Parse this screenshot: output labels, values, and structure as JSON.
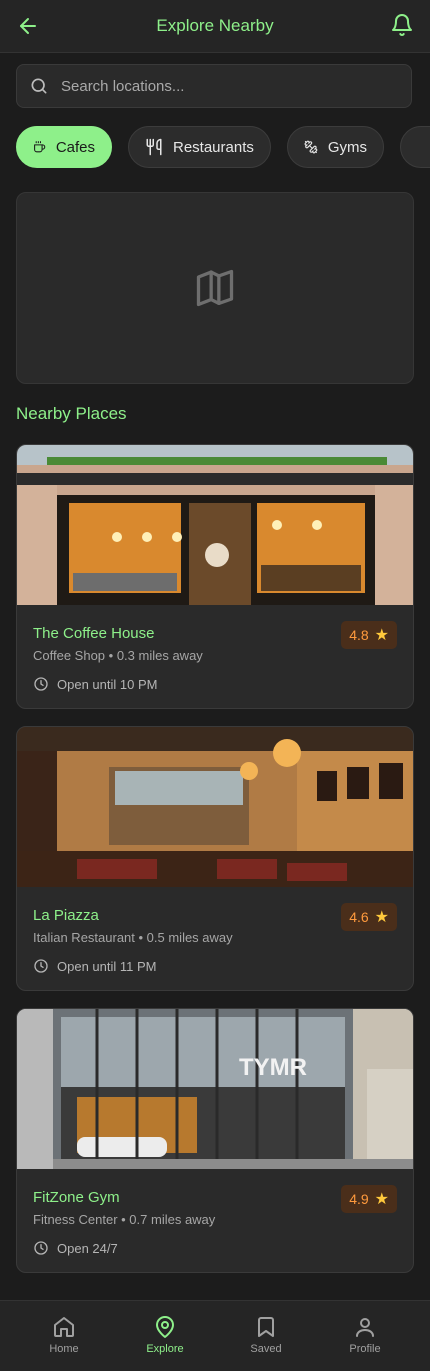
{
  "header": {
    "title": "Explore Nearby",
    "back_icon": "arrow-left-icon",
    "bell_icon": "bell-icon"
  },
  "search": {
    "placeholder": "Search locations...",
    "value": ""
  },
  "categories": [
    {
      "label": "Cafes",
      "icon": "coffee-icon",
      "active": true
    },
    {
      "label": "Restaurants",
      "icon": "utensils-icon",
      "active": false
    },
    {
      "label": "Gyms",
      "icon": "dumbbell-icon",
      "active": false
    }
  ],
  "map": {
    "icon": "map-icon"
  },
  "section_title": "Nearby Places",
  "places": [
    {
      "name": "The Coffee House",
      "meta": "Coffee Shop • 0.3 miles away",
      "hours": "Open until 10 PM",
      "rating": "4.8"
    },
    {
      "name": "La Piazza",
      "meta": "Italian Restaurant • 0.5 miles away",
      "hours": "Open until 11 PM",
      "rating": "4.6"
    },
    {
      "name": "FitZone Gym",
      "meta": "Fitness Center • 0.7 miles away",
      "hours": "Open 24/7",
      "rating": "4.9"
    }
  ],
  "photo_signage": "TYMR",
  "nav": [
    {
      "label": "Home",
      "icon": "home-icon",
      "active": false
    },
    {
      "label": "Explore",
      "icon": "map-pin-icon",
      "active": true
    },
    {
      "label": "Saved",
      "icon": "bookmark-icon",
      "active": false
    },
    {
      "label": "Profile",
      "icon": "user-icon",
      "active": false
    }
  ],
  "colors": {
    "accent": "#8ef08a",
    "background": "#1c1c1c",
    "card": "#2a2a2a",
    "rating_text": "#ff9a3d",
    "rating_bg": "#4a2e1a",
    "star": "#ffc93c"
  }
}
